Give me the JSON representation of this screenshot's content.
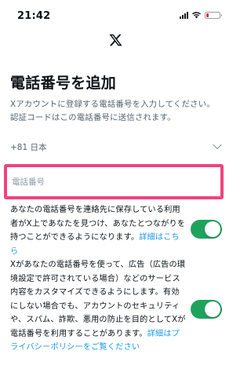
{
  "colors": {
    "accent_link": "#1d9bf0",
    "toggle_on": "#1fa35c",
    "highlight_border": "#f0437f",
    "battery_low": "#e0362c"
  },
  "status_bar": {
    "time": "21:42",
    "battery_level_fraction": 0.2,
    "icons": [
      "signal-icon",
      "wifi-icon",
      "battery-icon"
    ]
  },
  "header": {
    "logo_icon": "x-logo-icon"
  },
  "main": {
    "title": "電話番号を追加",
    "subtitle_line1": "Xアカウントに登録する電話番号を入力してください。",
    "subtitle_line2": "認証コードはこの電話番号に送信されます。",
    "country_code": "+81 日本",
    "phone_placeholder": "電話番号",
    "phone_value": ""
  },
  "options": [
    {
      "text": "あなたの電話番号を連絡先に保存している利用者がX上であなたを見つけ、あなたとつながりを持つことができるようになります。",
      "link": "詳細はこちら",
      "enabled": true
    },
    {
      "text": "Xがあなたの電話番号を使って、広告（広告の環境設定で許可されている場合）などのサービス内容をカスタマイズできるようにします。有効にしない場合でも、アカウントのセキュリティや、スパム、詐欺、悪用の防止を目的としてXが電話番号を利用することがあります。",
      "link": "詳細はプライバシーポリシーをご覧ください",
      "enabled": true
    }
  ]
}
